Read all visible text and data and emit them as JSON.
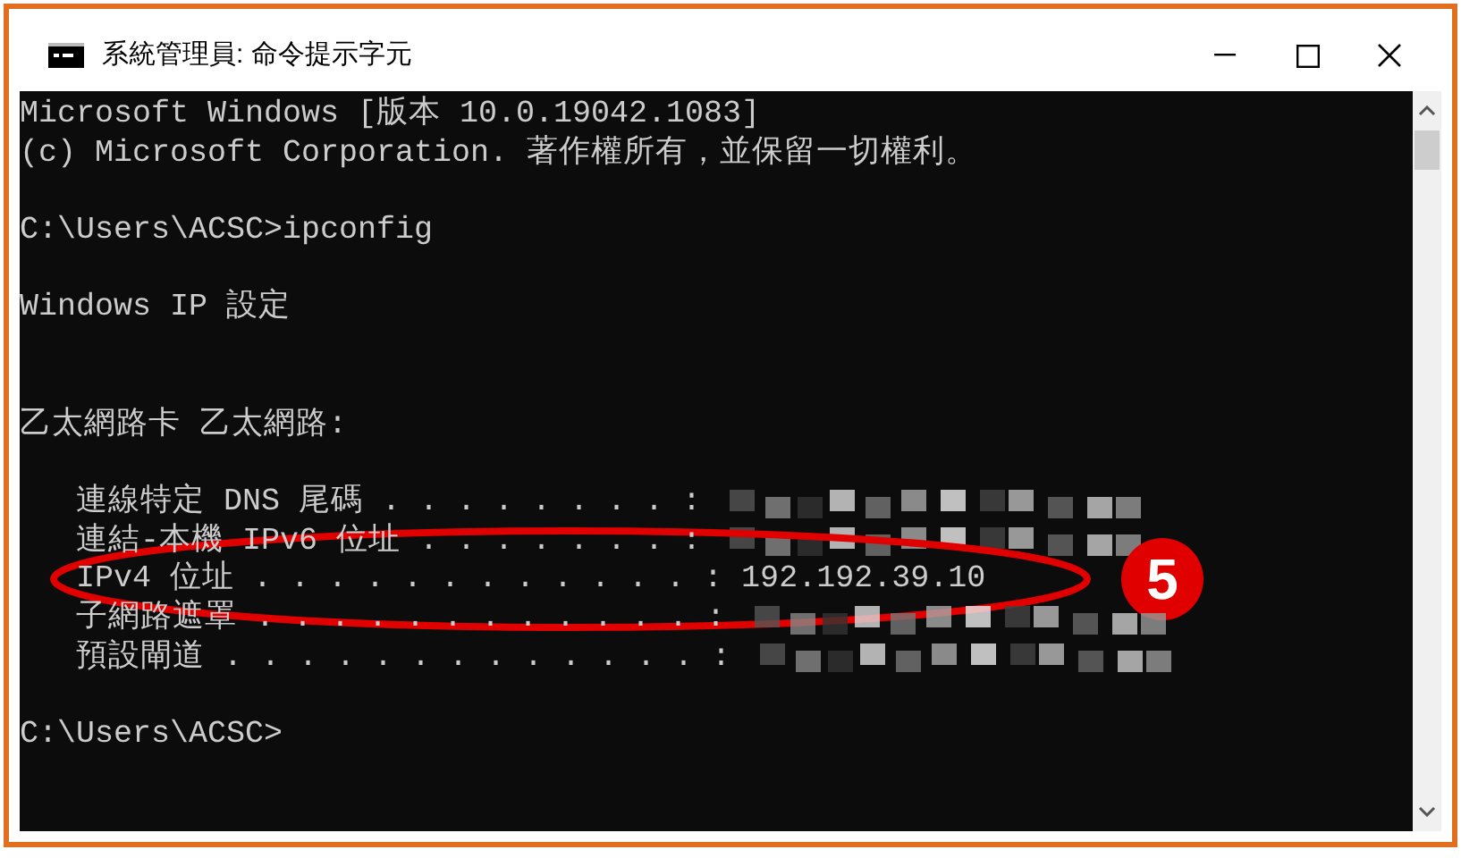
{
  "window": {
    "title": "系統管理員: 命令提示字元"
  },
  "console_lines": [
    {
      "kind": "text",
      "text": "Microsoft Windows [版本 10.0.19042.1083]"
    },
    {
      "kind": "text",
      "text": "(c) Microsoft Corporation. 著作權所有，並保留一切權利。"
    },
    {
      "kind": "blank"
    },
    {
      "kind": "text",
      "text": "C:\\Users\\ACSC>ipconfig"
    },
    {
      "kind": "blank"
    },
    {
      "kind": "text",
      "text": "Windows IP 設定"
    },
    {
      "kind": "blank"
    },
    {
      "kind": "blank"
    },
    {
      "kind": "text",
      "text": "乙太網路卡 乙太網路:"
    },
    {
      "kind": "blank"
    },
    {
      "kind": "field",
      "text": "   連線特定 DNS 尾碼 . . . . . . . . :",
      "redacted": true
    },
    {
      "kind": "field",
      "text": "   連結-本機 IPv6 位址 . . . . . . . :",
      "redacted": true
    },
    {
      "kind": "field",
      "text": "   IPv4 位址 . . . . . . . . . . . . : 192.192.39.10",
      "redacted": false,
      "highlighted": true
    },
    {
      "kind": "field",
      "text": "   子網路遮罩 . . . . . . . . . . . . :",
      "redacted": true
    },
    {
      "kind": "field",
      "text": "   預設閘道 . . . . . . . . . . . . . :",
      "redacted": true
    },
    {
      "kind": "blank"
    },
    {
      "kind": "text",
      "text": "C:\\Users\\ACSC>"
    }
  ],
  "step_badge": "5"
}
